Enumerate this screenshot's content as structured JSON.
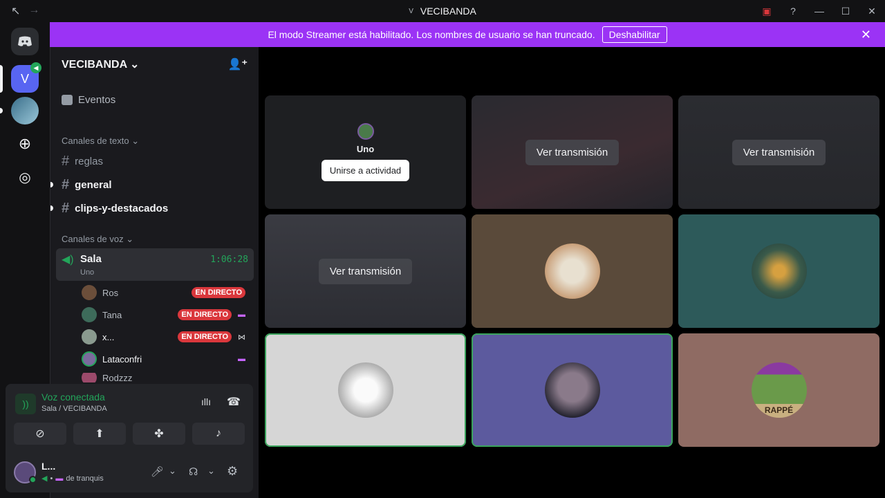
{
  "titlebar": {
    "title": "VECIBANDA",
    "badge": "V",
    "back_icon": "back-arrow-icon",
    "forward_icon": "forward-arrow-icon"
  },
  "banner": {
    "message": "El modo Streamer está habilitado. Los nombres de usuario se han truncado.",
    "button": "Deshabilitar",
    "color": "#9b33f5"
  },
  "guilds": {
    "active_initial": "V"
  },
  "server": {
    "name": "VECIBANDA",
    "events_label": "Eventos",
    "text_category": "Canales de texto",
    "text_channels": [
      {
        "name": "reglas"
      },
      {
        "name": "general"
      },
      {
        "name": "clips-y-destacados"
      }
    ],
    "voice_category": "Canales de voz",
    "voice_channel": {
      "name": "Sala",
      "sub": "Uno",
      "timer": "1:06:28"
    },
    "voice_users": [
      {
        "name": "Ros",
        "live": "EN DIRECTO",
        "color": "#6b4e3a"
      },
      {
        "name": "Tana",
        "live": "EN DIRECTO",
        "color": "#3d6b5a"
      },
      {
        "name": "x...",
        "live": "EN DIRECTO",
        "color": "#8a9a8f"
      },
      {
        "name": "Lataconfri",
        "live": "",
        "color": "#7a6b9c"
      },
      {
        "name": "Rodzzz",
        "live": "",
        "color": "#9c4a6b"
      }
    ]
  },
  "voice_panel": {
    "status": "Voz conectada",
    "location": "Sala / VECIBANDA",
    "user_name": "L...",
    "user_status": "de tranquis",
    "status_color": "#23a55a"
  },
  "tiles": [
    {
      "type": "activity",
      "name": "Uno",
      "button": "Unirse a actividad",
      "bg": "#1e1f22"
    },
    {
      "type": "stream",
      "label": "Ver transmisión",
      "bg": "#2a2a30"
    },
    {
      "type": "stream",
      "label": "Ver transmisión",
      "bg": "#2b2c31"
    },
    {
      "type": "stream",
      "label": "Ver transmisión",
      "bg": "#33343a"
    },
    {
      "type": "avatar",
      "bg": "#5a4a3a",
      "avatar_color": "#c9a07a"
    },
    {
      "type": "avatar",
      "bg": "#2d5a5a",
      "avatar_color": "#4a6b55"
    },
    {
      "type": "avatar",
      "bg": "#d6d6d6",
      "avatar_color": "#eaeaea",
      "speaking": true
    },
    {
      "type": "avatar",
      "bg": "#5c5a9e",
      "avatar_color": "#3a3a5a",
      "speaking": true
    },
    {
      "type": "avatar",
      "bg": "#8f6b63",
      "avatar_color": "#7aa05a",
      "avatar_text": "RAPPÉ"
    }
  ]
}
